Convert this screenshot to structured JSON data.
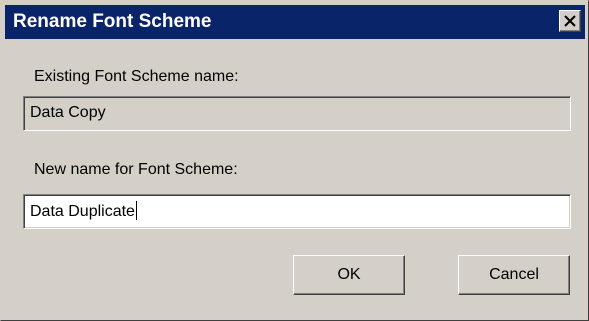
{
  "dialog": {
    "title": "Rename Font Scheme",
    "close_icon": "close-x"
  },
  "existing": {
    "label": "Existing Font Scheme name:",
    "value": "Data Copy"
  },
  "new_name": {
    "label": "New name for Font Scheme:",
    "value": "Data Duplicate"
  },
  "buttons": {
    "ok_label": "OK",
    "cancel_label": "Cancel"
  }
}
